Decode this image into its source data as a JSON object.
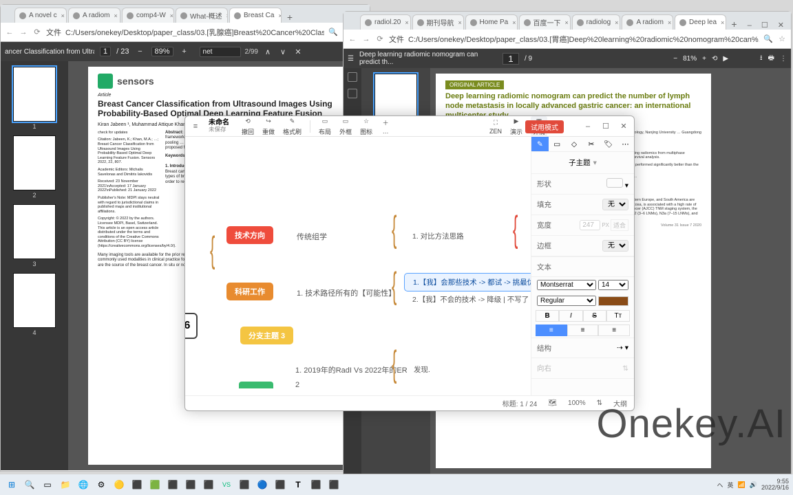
{
  "left_browser": {
    "tabs": [
      {
        "title": "A novel c",
        "active": false
      },
      {
        "title": "A radiom",
        "active": false
      },
      {
        "title": "comp4-W",
        "active": false
      },
      {
        "title": "What-概述",
        "active": false
      },
      {
        "title": "Breast Ca",
        "active": true
      }
    ],
    "address_prefix": "文件",
    "address": "C:/Users/onekey/Desktop/paper_class/03.[乳腺癌]Breast%20Cancer%20Classification%2...",
    "pdf": {
      "title": "ancer Classification from Ultrasou...",
      "page": "1",
      "pages": "23",
      "zoom": "89%",
      "find_term": "net",
      "find_count": "2/99",
      "thumbs": [
        "1",
        "2",
        "3",
        "4"
      ]
    },
    "paper": {
      "journal": "sensors",
      "article_label": "Article",
      "title": "Breast Cancer Classification from Ultrasound Images Using Probability-Based Optimal Deep Learning Feature Fusion",
      "authors": "Kiran Jabeen ¹, Muhammad Attique Khan¹, …, Ameer Hamza ¹, Artūras Mickus ² and …",
      "side_check": "check for updates",
      "side_citation": "Citation: Jabeen, K.; Khan, M.A.; …; Breast Cancer Classification from Ultrasound Images Using Probability-Based Optimal Deep Learning Feature Fusion. Sensors 2022, 22, 807.",
      "side_editors": "Academic Editors: Michalis Savelonas and Dimitris Iakovidis",
      "side_dates": "Received: 23 November 2021\\nAccepted: 17 January 2022\\nPublished: 21 January 2022",
      "side_note": "Publisher's Note: MDPI stays neutral with regard to jurisdictional claims in published maps and institutional affiliations.",
      "side_copy": "Copyright: © 2022 by the authors. Licensee MDPI, Basel, Switzerland. This article is an open access article distributed under the terms and conditions of the Creative Commons Attribution (CC BY) license (https://creativecommons.org/licenses/by/4.0/).",
      "abs_label": "Abstract:",
      "abstract": "After lung cancer, breast cancer is the second leading cause of death … a diagnosis framework … proposes a deep learning … for better learning … the modifications … average pooling … known as reweighted … selected features … learning algorithm … BUSI dataset … proposed framework …",
      "hl_text": "model to create",
      "kw_label": "Keywords:",
      "body_h": "1. Introduction",
      "body": "Breast cancer is the second most common cancer … spreads to the bone marrow, liver, lung … types of breast cancer … characteristics. It is critical to detect breast cancer at an early stage in order to reduce the mortality rate [4].",
      "body2": "Many imaging tools are available for the prior recognition and early treatment of breast cancer. Breast ultrasound is one of the most commonly used modalities in clinical practice for the diagnosis process [5,6]. Epithelial cells that border the terminal duct lobular unit are the source of the breast cancer. In situ or noninvasive cancer cells …"
    }
  },
  "right_browser": {
    "tabs": [
      {
        "title": "radiol.20"
      },
      {
        "title": "期刊导航"
      },
      {
        "title": "Home Pa"
      },
      {
        "title": "百度一下"
      },
      {
        "title": "radiolog"
      },
      {
        "title": "A radiom"
      },
      {
        "title": "Deep lea",
        "active": true
      }
    ],
    "address_prefix": "文件",
    "address": "C:/Users/onekey/Desktop/paper_class/03.[胃癌]Deep%20learning%20radiomic%20nomogram%20can%...",
    "pdf": {
      "title": "Deep learning radiomic nomogram can predict th...",
      "page": "1",
      "pages": "9",
      "zoom": "81%"
    },
    "paper": {
      "badge": "ORIGINAL ARTICLE",
      "title": "Deep learning radiomic nomogram can predict the number of lymph node metastasis in locally advanced gastric cancer: an international multicenter study",
      "authors": "… X.F. Wang¹, K. Chen²,³, X.X. Wang⁴ …",
      "affil": "Institute, Beijing; School of Artificial Intelligence, University of Chinese Academy of Sciences; Department of Radiology, Nanjing University … Guangdong Provincial People's Hospital … Italy; Laboratory of Carcinogenesis and Translational Research …",
      "abs1": "… node metastasis (LNM) is the basis of individual treatment, the routinely used preoperative determination …",
      "abs2": "… centers in China and one center in Italy, and divided them into one international validation cohort. A deep learning radiomics from multiphase computed tomography (CT) for comprehensively tested the DLRN and compared it to the value of the DLRN in survival analysis.",
      "abs3": "On all cohorts (overall C-indexes (95% confidence interval 0.821) in the external validation cohorts, and 0.822 on performed significantly better than the routinely … Besides, DLRN was significantly associated with the …",
      "abs4": "… predictive value for LNM in LAGC. In staging-oriented … wide baseline information for individual treatment of …",
      "kw": "… node metastasis, radiomic nomogram",
      "sec": "Introduction",
      "intro": "Gastric cancer is the third leading cause of death from cancer [1]. The gastric cancer incidence rates in Asia, Eastern Europe, and South America are relatively high … locally advanced gastric cancer (LAGC), characterized as wall invasion deeper than the submucosa, is associated with a high rate of lymph node metastasis (LNM) and poor clinical outcomes. According to the 8th American Joint Committee on Cancer (AJCC) TNM staging system, the severity of lymph node (LN) involvement is classified on the number of LNMs as N0 (no LNM), N1 (1–2 LNMs), N2 (3–6 LNMs), N3a (7–15 LNMs), and N3b (over 15 LNMs).",
      "foot_vol": "Volume 31    Issue 7    2020"
    }
  },
  "mindmap": {
    "title": "未命名",
    "subtitle": "未保存",
    "menu_hamburger": "≡",
    "toolbar": [
      {
        "icon": "⟲",
        "label": "撤回"
      },
      {
        "icon": "↪",
        "label": "重做"
      },
      {
        "icon": "✎",
        "label": "格式刷"
      },
      {
        "icon": "▭",
        "label": "布局"
      },
      {
        "icon": "▭",
        "label": "外框"
      },
      {
        "icon": "☆",
        "label": "图标"
      },
      {
        "icon": "＋",
        "label": "…"
      }
    ],
    "right_icons": [
      {
        "icon": "⛶",
        "label": "ZEN"
      },
      {
        "icon": "▶",
        "label": "演示"
      },
      {
        "icon": "▦",
        "label": "详情"
      }
    ],
    "trial_badge": "试用模式",
    "win_buttons": [
      "–",
      "☐",
      "✕"
    ],
    "colorbar_colors": [
      "#4c8eff",
      "#e0e0e0",
      "#e0e0e0",
      "#e0e0e0",
      "#e0e0e0",
      "#e0e0e0"
    ],
    "panel": {
      "subtopic": "子主题",
      "shape": "形状",
      "shape_value": "▭",
      "fill": "填充",
      "fill_value": "无",
      "width": "宽度",
      "width_value": "247",
      "width_unit": "PX",
      "width_fit": "适合",
      "border": "边框",
      "border_value": "无",
      "text": "文本",
      "font": "Montserrat",
      "fontsize": "14",
      "weight": "Regular",
      "color": "#8a4c17",
      "bold": "B",
      "italic": "I",
      "strike": "S",
      "case": "Tт",
      "align_left": "≡",
      "align_center": "≡",
      "align_right": "≡",
      "struct": "结构",
      "struct_value": "⇢",
      "dir": "向右"
    },
    "nodes": {
      "chip": "6",
      "red": "技术方向",
      "red_sub": "传统组学",
      "child1": "1. 对比方法思路",
      "orn": "科研工作",
      "orn_sub": "1. 技术路径所有的【可能性】",
      "oc1": "1.【我】会那些技术 -> 都试 -> 挑最优",
      "oc1_selected": true,
      "oc2": "2.【我】不会的技术 -> 降级 | 不写了",
      "yel": "分支主题 3",
      "grn_sub1": "1. 2019年的RadI Vs 2022年的ER",
      "grn_sub1_tail": "发现.",
      "grn_sub2": "2"
    },
    "status": {
      "title_label": "标题:",
      "pos": "1 / 24",
      "zoom": "100%",
      "mode": "大纲"
    }
  },
  "watermark": "Onekey.AI",
  "taskbar": {
    "icons": [
      "▦",
      "🔍",
      "📁",
      "🧭",
      "📂",
      "⚙",
      "🌐",
      "⬛",
      "🟩",
      "⬛",
      "⬛",
      "⬛",
      "VS",
      "⬛",
      "🔵",
      "⬛",
      "T",
      "⬛",
      "⬛"
    ],
    "tray": {
      "up": "ヘ",
      "lang": "英",
      "net": "📶",
      "vol": "🔊",
      "time": "9:55",
      "date": "2022/9/16"
    }
  }
}
